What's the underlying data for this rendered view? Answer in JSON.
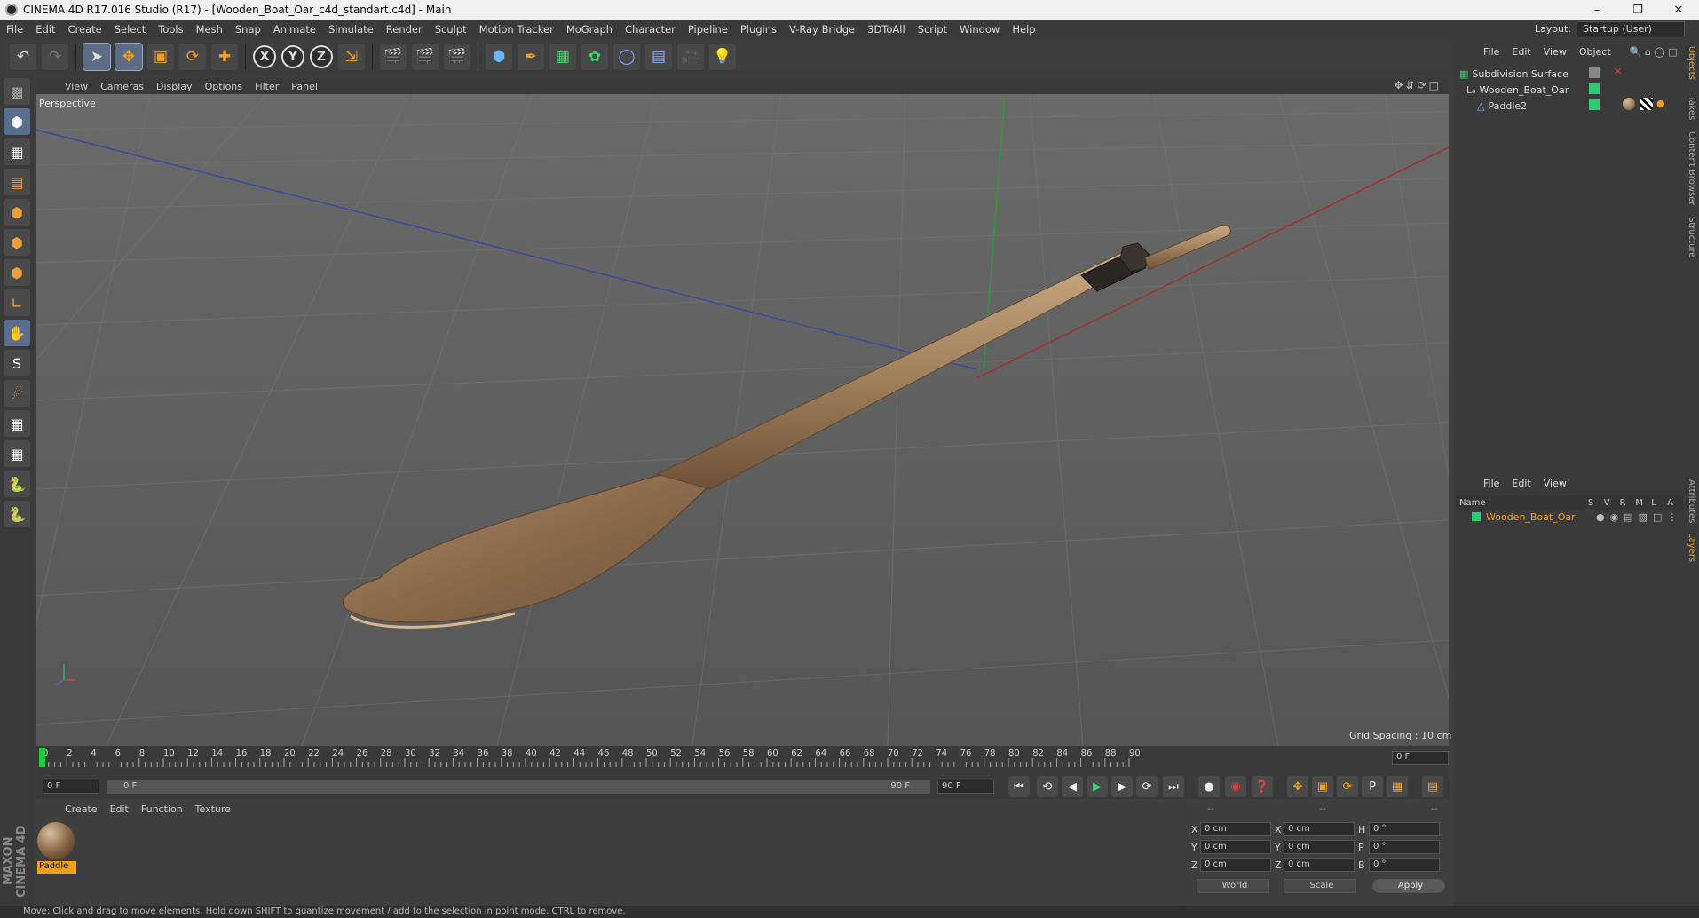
{
  "window": {
    "title": "CINEMA 4D R17.016 Studio (R17) - [Wooden_Boat_Oar_c4d_standart.c4d] - Main"
  },
  "menu": [
    "File",
    "Edit",
    "Create",
    "Select",
    "Tools",
    "Mesh",
    "Snap",
    "Animate",
    "Simulate",
    "Render",
    "Sculpt",
    "Motion Tracker",
    "MoGraph",
    "Character",
    "Pipeline",
    "Plugins",
    "V-Ray Bridge",
    "3DToAll",
    "Script",
    "Window",
    "Help"
  ],
  "layout": {
    "label": "Layout:",
    "value": "Startup (User)"
  },
  "viewport": {
    "menu": [
      "View",
      "Cameras",
      "Display",
      "Options",
      "Filter",
      "Panel"
    ],
    "label": "Perspective",
    "grid_spacing": "Grid Spacing : 10 cm"
  },
  "timeline": {
    "ticks": [
      "0",
      "2",
      "4",
      "6",
      "8",
      "10",
      "12",
      "14",
      "16",
      "18",
      "20",
      "22",
      "24",
      "26",
      "28",
      "30",
      "32",
      "34",
      "36",
      "38",
      "40",
      "42",
      "44",
      "46",
      "48",
      "50",
      "52",
      "54",
      "56",
      "58",
      "60",
      "62",
      "64",
      "66",
      "68",
      "70",
      "72",
      "74",
      "76",
      "78",
      "80",
      "82",
      "84",
      "86",
      "88",
      "90"
    ],
    "current_frame": "0 F",
    "start_field": "0 F",
    "range_start": "0 F",
    "range_end": "90 F",
    "end_field": "90 F"
  },
  "material_manager": {
    "menu": [
      "Create",
      "Edit",
      "Function",
      "Texture"
    ],
    "material_name": "Paddle"
  },
  "coordinates": {
    "header": [
      "--",
      "--",
      "--"
    ],
    "rows": [
      {
        "a": "X",
        "av": "0 cm",
        "b": "X",
        "bv": "0 cm",
        "c": "H",
        "cv": "0 °"
      },
      {
        "a": "Y",
        "av": "0 cm",
        "b": "Y",
        "bv": "0 cm",
        "c": "P",
        "cv": "0 °"
      },
      {
        "a": "Z",
        "av": "0 cm",
        "b": "Z",
        "bv": "0 cm",
        "c": "B",
        "cv": "0 °"
      }
    ],
    "mode1": "World",
    "mode2": "Scale",
    "apply": "Apply"
  },
  "object_manager": {
    "menu": [
      "File",
      "Edit",
      "View",
      "Object"
    ],
    "objects": [
      "Subdivision Surface",
      "Wooden_Boat_Oar",
      "Paddle2"
    ]
  },
  "layer_manager": {
    "menu": [
      "File",
      "Edit",
      "View"
    ],
    "columns": [
      "Name",
      "S",
      "V",
      "R",
      "M",
      "L",
      "A"
    ],
    "layer": "Wooden_Boat_Oar"
  },
  "side_tabs": [
    "Objects",
    "Takes",
    "Content Browser",
    "Structure",
    "Attributes",
    "Layers"
  ],
  "status": "Move: Click and drag to move elements. Hold down SHIFT to quantize movement / add to the selection in point mode, CTRL to remove.",
  "branding": "MAXON CINEMA 4D",
  "colors": {
    "accent": "#f2a01c",
    "layer_green": "#2ecc71",
    "timeline_marker": "#22cc44"
  }
}
